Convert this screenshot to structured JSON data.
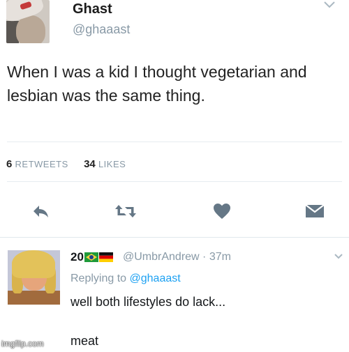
{
  "tweet": {
    "name": "Ghast",
    "handle": "@ghaaast",
    "text": "When I was a kid I thought vegetarian and lesbian was the same thing.",
    "stats": {
      "retweets_count": "6",
      "retweets_label": "RETWEETS",
      "likes_count": "34",
      "likes_label": "LIKES"
    },
    "actions": [
      {
        "icon": "reply-icon"
      },
      {
        "icon": "retweet-icon"
      },
      {
        "icon": "heart-icon"
      },
      {
        "icon": "envelope-icon"
      }
    ]
  },
  "reply": {
    "name": "20",
    "flags": [
      "brazil-flag",
      "germany-flag"
    ],
    "handle_time": "@UmbrAndrew · 37m",
    "replying_prefix": "Replying to",
    "replying_mention": "@ghaaast",
    "text_line_1": "well both lifestyles do lack...",
    "text_line_2": "meat"
  },
  "watermark": "imgflip.com",
  "colors": {
    "secondary_text": "#8899a6",
    "link": "#1da1f2",
    "icon": "#657786"
  }
}
